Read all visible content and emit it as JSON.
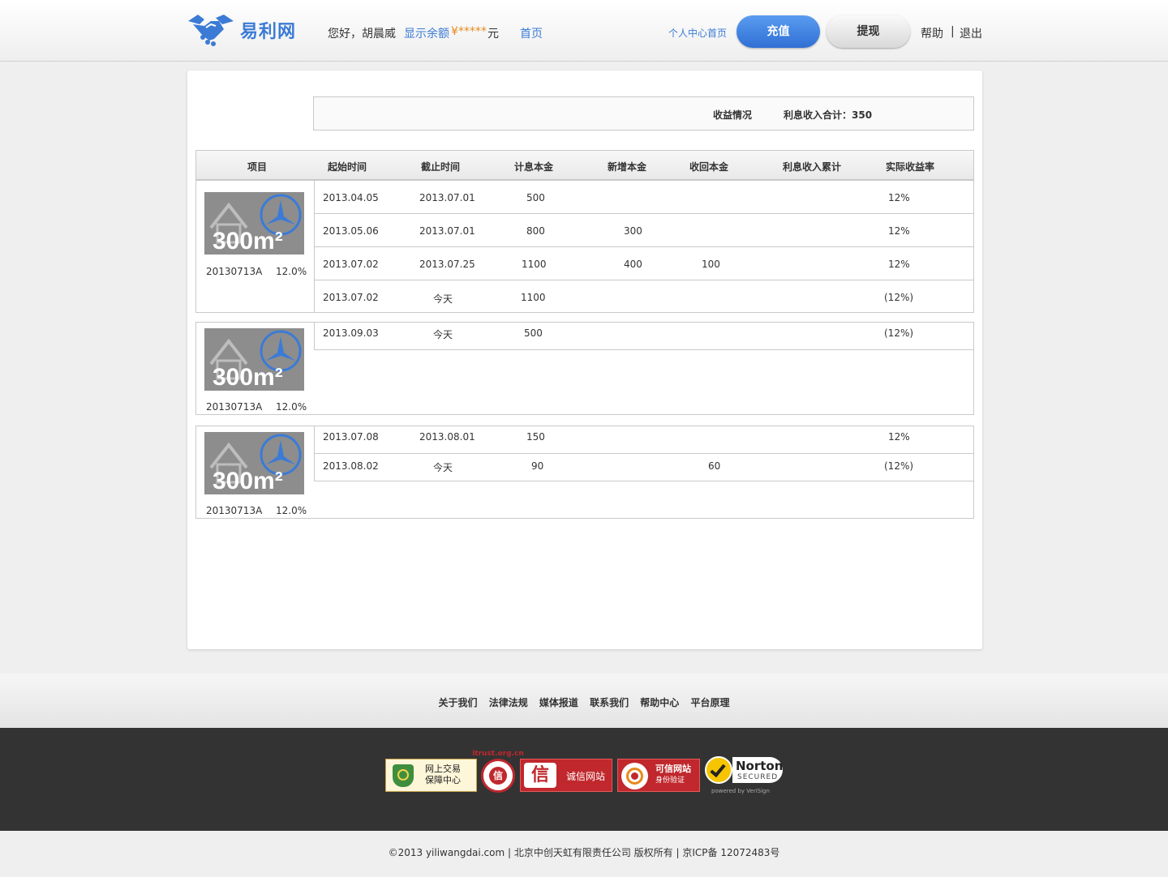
{
  "header": {
    "logo_text": "易利网",
    "greeting": "您好，胡晨威",
    "balance_link": "显示余额",
    "balance_value": "¥*****",
    "balance_unit": "元",
    "home_link": "首页",
    "personal_center_link": "个人中心首页",
    "recharge_button": "充值",
    "withdraw_button": "提现",
    "help_link": "帮助",
    "separator": "|",
    "logout_link": "退出"
  },
  "summary": {
    "label": "收益情况",
    "interest_total": "利息收入合计：350"
  },
  "table": {
    "headers": [
      "项目",
      "起始时间",
      "截止时间",
      "计息本金",
      "新增本金",
      "收回本金",
      "利息收入累计",
      "实际收益率"
    ],
    "groups": [
      {
        "thumb_text": "300m²",
        "code": "20130713A",
        "rate": "12.0%",
        "rows": [
          {
            "start": "2013.04.05",
            "end": "2013.07.01",
            "principal": "500",
            "added": "",
            "returned": "",
            "interest": "",
            "yield": "12%"
          },
          {
            "start": "2013.05.06",
            "end": "2013.07.01",
            "principal": "800",
            "added": "300",
            "returned": "",
            "interest": "",
            "yield": "12%"
          },
          {
            "start": "2013.07.02",
            "end": "2013.07.25",
            "principal": "1100",
            "added": "400",
            "returned": "100",
            "interest": "",
            "yield": "12%"
          },
          {
            "start": "2013.07.02",
            "end": "今天",
            "principal": "1100",
            "added": "",
            "returned": "",
            "interest": "",
            "yield": "(12%)"
          }
        ]
      },
      {
        "thumb_text": "300m²",
        "code": "20130713A",
        "rate": "12.0%",
        "rows": [
          {
            "start": "2013.09.03",
            "end": "今天",
            "principal": "500",
            "added": "",
            "returned": "",
            "interest": "",
            "yield": "(12%)"
          }
        ]
      },
      {
        "thumb_text": "300m²",
        "code": "20130713A",
        "rate": "12.0%",
        "rows": [
          {
            "start": "2013.07.08",
            "end": "2013.08.01",
            "principal": "150",
            "added": "",
            "returned": "",
            "interest": "",
            "yield": "12%"
          },
          {
            "start": "2013.08.02",
            "end": "今天",
            "principal": "90",
            "added": "",
            "returned": "60",
            "interest": "",
            "yield": "(12%)"
          }
        ]
      }
    ]
  },
  "footer": {
    "links": [
      "关于我们",
      "法律法规",
      "媒体报道",
      "联系我们",
      "帮助中心",
      "平台原理"
    ],
    "badges": [
      {
        "line1": "网上交易",
        "line2": "保障中心"
      },
      {
        "text": "信",
        "ring": "itrust.org.cn"
      },
      {
        "text": "诚信网站"
      },
      {
        "line1": "可信网站",
        "line2": "身份验证"
      },
      {
        "brand": "Norton",
        "sub": "SECURED",
        "powered": "powered by VeriSign"
      }
    ],
    "copyright": "©2013 yiliwangdai.com | 北京中创天虹有限责任公司 版权所有 | 京ICP备 12072483号"
  }
}
